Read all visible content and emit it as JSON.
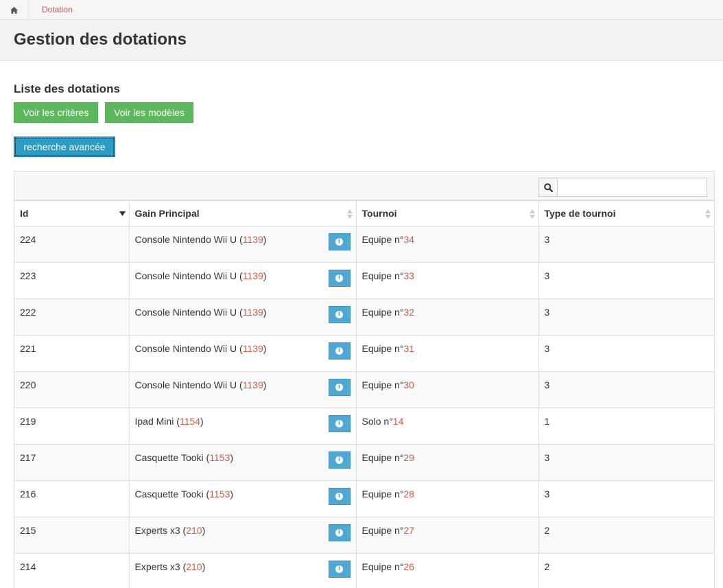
{
  "breadcrumb": {
    "current": "Dotation"
  },
  "page": {
    "title": "Gestion des dotations"
  },
  "section": {
    "title": "Liste des dotations"
  },
  "buttons": {
    "criteria": "Voir les critères",
    "models": "Voir les modèles",
    "advanced_search": "recherche avancée"
  },
  "search": {
    "placeholder": "",
    "value": ""
  },
  "columns": [
    "Id",
    "Gain Principal",
    "Tournoi",
    "Type de tournoi"
  ],
  "rows": [
    {
      "id": "224",
      "gain": "Console Nintendo Wii U",
      "gain_ref": "1139",
      "tournoi_label": "Equipe n°",
      "tournoi_num": "34",
      "type": "3"
    },
    {
      "id": "223",
      "gain": "Console Nintendo Wii U",
      "gain_ref": "1139",
      "tournoi_label": "Equipe n°",
      "tournoi_num": "33",
      "type": "3"
    },
    {
      "id": "222",
      "gain": "Console Nintendo Wii U",
      "gain_ref": "1139",
      "tournoi_label": "Equipe n°",
      "tournoi_num": "32",
      "type": "3"
    },
    {
      "id": "221",
      "gain": "Console Nintendo Wii U",
      "gain_ref": "1139",
      "tournoi_label": "Equipe n°",
      "tournoi_num": "31",
      "type": "3"
    },
    {
      "id": "220",
      "gain": "Console Nintendo Wii U",
      "gain_ref": "1139",
      "tournoi_label": "Equipe n°",
      "tournoi_num": "30",
      "type": "3"
    },
    {
      "id": "219",
      "gain": "Ipad Mini",
      "gain_ref": "1154",
      "tournoi_label": "Solo n°",
      "tournoi_num": "14",
      "type": "1"
    },
    {
      "id": "217",
      "gain": "Casquette Tooki",
      "gain_ref": "1153",
      "tournoi_label": "Equipe n°",
      "tournoi_num": "29",
      "type": "3"
    },
    {
      "id": "216",
      "gain": "Casquette Tooki",
      "gain_ref": "1153",
      "tournoi_label": "Equipe n°",
      "tournoi_num": "28",
      "type": "3"
    },
    {
      "id": "215",
      "gain": "Experts x3",
      "gain_ref": "210",
      "tournoi_label": "Equipe n°",
      "tournoi_num": "27",
      "type": "2"
    },
    {
      "id": "214",
      "gain": "Experts x3",
      "gain_ref": "210",
      "tournoi_label": "Equipe n°",
      "tournoi_num": "26",
      "type": "2"
    }
  ],
  "colors": {
    "link": "#d15b47",
    "success": "#5cb85c",
    "info": "#4ea8d4",
    "primary": "#2a9dc4"
  },
  "icons": {
    "home": "home-icon",
    "search": "search-icon",
    "info": "info-icon",
    "sort": "sort-icon"
  }
}
